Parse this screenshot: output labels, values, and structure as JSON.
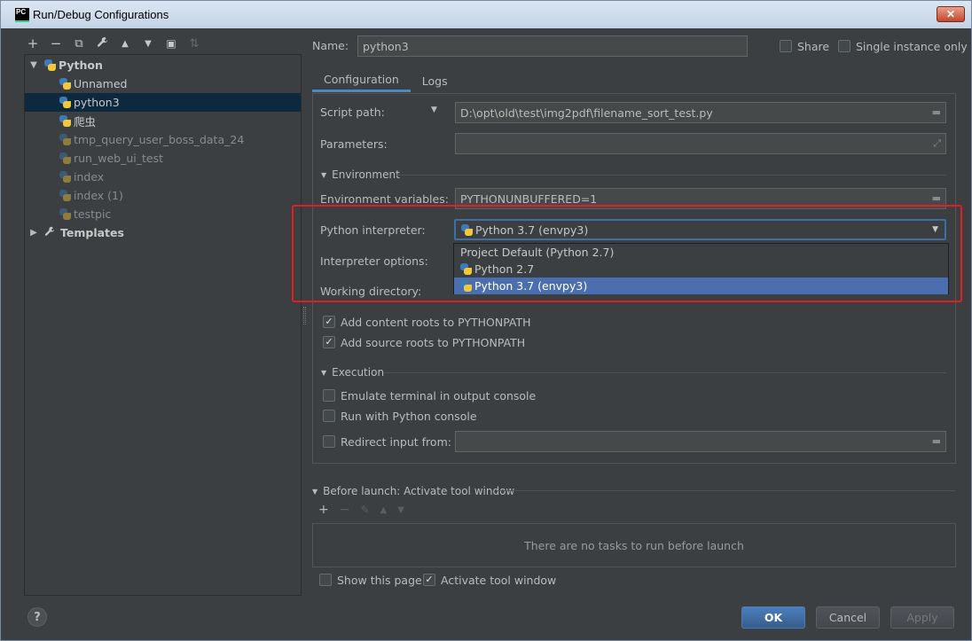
{
  "window": {
    "title": "Run/Debug Configurations",
    "app_icon": "PC",
    "close": "✕"
  },
  "left_toolbar": [
    {
      "name": "add-icon",
      "glyph": "+"
    },
    {
      "name": "remove-icon",
      "glyph": "−"
    },
    {
      "name": "copy-icon",
      "glyph": "⧉"
    },
    {
      "name": "wrench-icon",
      "glyph": "🔧"
    },
    {
      "name": "move-up-icon",
      "glyph": "▲"
    },
    {
      "name": "move-down-icon",
      "glyph": "▼"
    },
    {
      "name": "folder-icon",
      "glyph": "▣"
    },
    {
      "name": "sort-icon",
      "glyph": "⇅"
    }
  ],
  "tree": {
    "python_group": "Python",
    "items": [
      {
        "label": "Unnamed"
      },
      {
        "label": "python3"
      },
      {
        "label": "爬虫"
      },
      {
        "label": "tmp_query_user_boss_data_24"
      },
      {
        "label": "run_web_ui_test"
      },
      {
        "label": "index"
      },
      {
        "label": "index (1)"
      },
      {
        "label": "testpic"
      }
    ],
    "templates": "Templates"
  },
  "help": "?",
  "form": {
    "name_label": "Name:",
    "name_value": "python3",
    "share_label": "Share",
    "single_instance_label": "Single instance only",
    "tabs": [
      "Configuration",
      "Logs"
    ],
    "script_path_label": "Script path:",
    "script_path_value": "D:\\opt\\old\\test\\img2pdf\\filename_sort_test.py",
    "parameters_label": "Parameters:",
    "parameters_value": "",
    "environment_section": "Environment",
    "env_vars_label": "Environment variables:",
    "env_vars_value": "PYTHONUNBUFFERED=1",
    "interpreter_label": "Python interpreter:",
    "interpreter_value": "Python 3.7 (envpy3)",
    "interpreter_options": [
      "Project Default (Python 2.7)",
      "Python 2.7",
      "Python 3.7 (envpy3)"
    ],
    "interpreter_options_label": "Interpreter options:",
    "working_dir_label": "Working directory:",
    "add_content_roots": "Add content roots to PYTHONPATH",
    "add_source_roots": "Add source roots to PYTHONPATH",
    "execution_section": "Execution",
    "emulate_terminal": "Emulate terminal in output console",
    "run_with_console": "Run with Python console",
    "redirect_input": "Redirect input from:",
    "redirect_value": ""
  },
  "before_launch": {
    "title": "Before launch: Activate tool window",
    "empty_message": "There are no tasks to run before launch",
    "show_page": "Show this page",
    "activate_tool_window": "Activate tool window"
  },
  "buttons": {
    "ok": "OK",
    "cancel": "Cancel",
    "apply": "Apply"
  },
  "colors": {
    "accent": "#4b6eaf",
    "highlight_box": "#e02020",
    "background": "#3c3f41"
  }
}
